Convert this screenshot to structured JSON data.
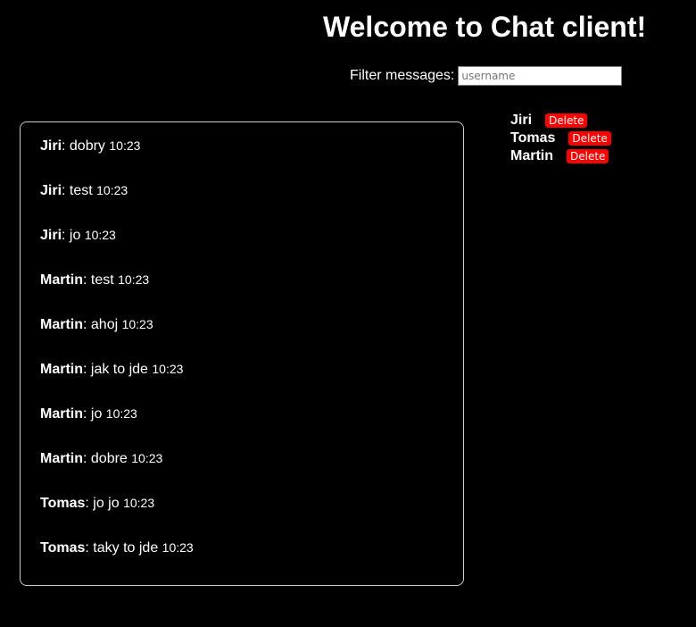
{
  "header": {
    "title": "Welcome to Chat client!"
  },
  "filter": {
    "label": "Filter messages:",
    "placeholder": "username",
    "value": ""
  },
  "messages": [
    {
      "author": "Jiri",
      "text": ": dobry ",
      "time": "10:23"
    },
    {
      "author": "Jiri",
      "text": ": test ",
      "time": "10:23"
    },
    {
      "author": "Jiri",
      "text": ": jo ",
      "time": "10:23"
    },
    {
      "author": "Martin",
      "text": ": test ",
      "time": "10:23"
    },
    {
      "author": "Martin",
      "text": ": ahoj ",
      "time": "10:23"
    },
    {
      "author": "Martin",
      "text": ": jak to jde ",
      "time": "10:23"
    },
    {
      "author": "Martin",
      "text": ": jo ",
      "time": "10:23"
    },
    {
      "author": "Martin",
      "text": ": dobre ",
      "time": "10:23"
    },
    {
      "author": "Tomas",
      "text": ": jo jo ",
      "time": "10:23"
    },
    {
      "author": "Tomas",
      "text": ": taky to jde ",
      "time": "10:23"
    }
  ],
  "users": [
    {
      "name": "Jiri",
      "delete_label": "Delete"
    },
    {
      "name": "Tomas",
      "delete_label": "Delete"
    },
    {
      "name": "Martin",
      "delete_label": "Delete"
    }
  ],
  "colors": {
    "background": "#000000",
    "text": "#ffffff",
    "delete_button": "#ff0000"
  }
}
